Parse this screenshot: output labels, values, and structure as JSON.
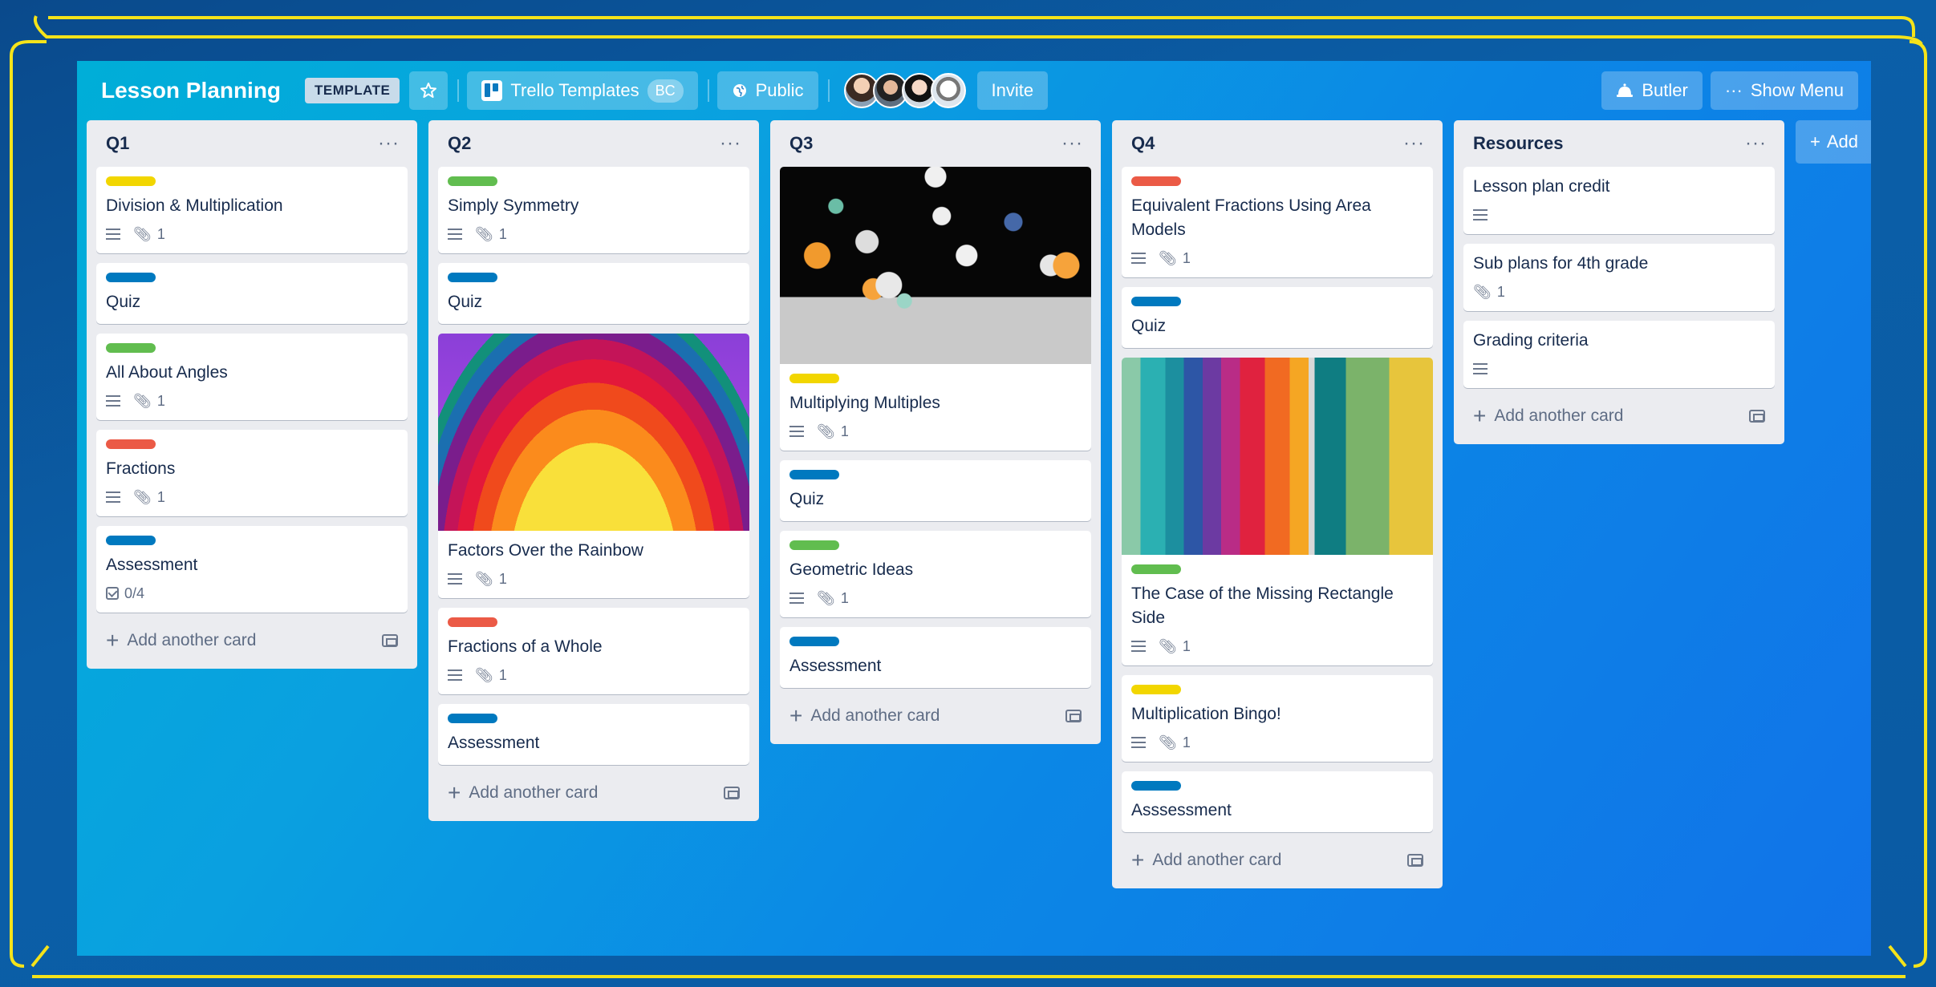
{
  "header": {
    "board_title": "Lesson Planning",
    "template_badge": "TEMPLATE",
    "workspace_label": "Trello Templates",
    "workspace_badge": "BC",
    "visibility_label": "Public",
    "invite_label": "Invite",
    "butler_label": "Butler",
    "show_menu_label": "Show Menu",
    "menu_dots": "···"
  },
  "lists": [
    {
      "title": "Q1",
      "cards": [
        {
          "label_color": "#f2d600",
          "title": "Division & Multiplication",
          "attachments": "1"
        },
        {
          "label_color": "#0079bf",
          "title": "Quiz"
        },
        {
          "label_color": "#61bd4f",
          "title": "All About Angles",
          "attachments": "1"
        },
        {
          "label_color": "#eb5a46",
          "title": "Fractions",
          "attachments": "1"
        },
        {
          "label_color": "#0079bf",
          "title": "Assessment",
          "checklist": "0/4"
        }
      ],
      "add_card": "Add another card"
    },
    {
      "title": "Q2",
      "cards": [
        {
          "label_color": "#61bd4f",
          "title": "Simply Symmetry",
          "attachments": "1"
        },
        {
          "label_color": "#0079bf",
          "title": "Quiz"
        },
        {
          "cover": "rainbow",
          "title": "Factors Over the Rainbow",
          "attachments": "1"
        },
        {
          "label_color": "#eb5a46",
          "title": "Fractions of a Whole",
          "attachments": "1"
        },
        {
          "label_color": "#0079bf",
          "title": "Assessment"
        }
      ],
      "add_card": "Add another card"
    },
    {
      "title": "Q3",
      "cards": [
        {
          "cover": "spheres",
          "label_color": "#f2d600",
          "title": "Multiplying Multiples",
          "attachments": "1"
        },
        {
          "label_color": "#0079bf",
          "title": "Quiz"
        },
        {
          "label_color": "#61bd4f",
          "title": "Geometric Ideas",
          "attachments": "1"
        },
        {
          "label_color": "#0079bf",
          "title": "Assessment"
        }
      ],
      "add_card": "Add another card"
    },
    {
      "title": "Q4",
      "cards": [
        {
          "label_color": "#eb5a46",
          "title": "Equivalent Fractions Using Area Models",
          "attachments": "1"
        },
        {
          "label_color": "#0079bf",
          "title": "Quiz"
        },
        {
          "cover": "corridor",
          "label_color": "#61bd4f",
          "title": "The Case of the Missing Rectangle Side",
          "attachments": "1"
        },
        {
          "label_color": "#f2d600",
          "title": "Multiplication Bingo!",
          "attachments": "1"
        },
        {
          "label_color": "#0079bf",
          "title": "Asssessment"
        }
      ],
      "add_card": "Add another card"
    },
    {
      "title": "Resources",
      "cards": [
        {
          "title": "Lesson plan credit",
          "description_only": true
        },
        {
          "title": "Sub plans for 4th grade",
          "attachments": "1",
          "no_description": true
        },
        {
          "title": "Grading criteria",
          "description_only": true
        }
      ],
      "add_card": "Add another card"
    }
  ],
  "add_list": "Add",
  "colors": {
    "frame": "#f5e31a",
    "list_bg": "#ebecf0",
    "text": "#172b4d"
  }
}
